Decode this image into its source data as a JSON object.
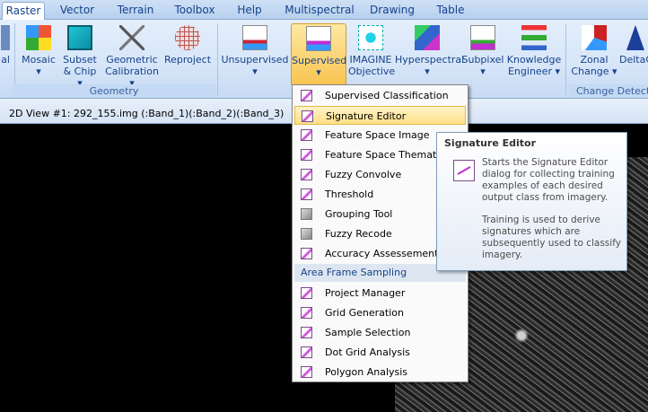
{
  "tabs": [
    "Raster",
    "Vector",
    "Terrain",
    "Toolbox",
    "Help",
    "Multispectral",
    "Drawing",
    "Table"
  ],
  "ribbon": {
    "buttons": [
      {
        "label": "al",
        "label2": "",
        "arrow": "▾"
      },
      {
        "label": "Mosaic",
        "label2": "▾"
      },
      {
        "label": "Subset",
        "label2": "& Chip ▾"
      },
      {
        "label": "Geometric",
        "label2": "Calibration ▾"
      },
      {
        "label": "Reproject",
        "label2": ""
      },
      {
        "label": "Unsupervised",
        "label2": "▾"
      },
      {
        "label": "Supervised",
        "label2": "▾"
      },
      {
        "label": "IMAGINE",
        "label2": "Objective"
      },
      {
        "label": "Hyperspectral",
        "label2": "▾"
      },
      {
        "label": "Subpixel",
        "label2": "▾"
      },
      {
        "label": "Knowledge",
        "label2": "Engineer ▾"
      },
      {
        "label": "Zonal",
        "label2": "Change ▾"
      },
      {
        "label": "DeltaC",
        "label2": ""
      }
    ],
    "groups": [
      "Geometry",
      "Change Detecti"
    ]
  },
  "viewbar": "2D View #1: 292_155.img (:Band_1)(:Band_2)(:Band_3)",
  "menu": {
    "items1": [
      "Supervised Classification",
      "Signature Editor",
      "Feature Space Image",
      "Feature Space Thematic",
      "Fuzzy Convolve",
      "Threshold",
      "Grouping Tool",
      "Fuzzy Recode",
      "Accuracy Assessement"
    ],
    "header": "Area Frame Sampling",
    "items2": [
      "Project Manager",
      "Grid Generation",
      "Sample Selection",
      "Dot Grid Analysis",
      "Polygon Analysis"
    ]
  },
  "tooltip": {
    "title": "Signature Editor",
    "p1": "Starts the Signature Editor dialog for collecting training examples of each desired output class from imagery.",
    "p2": "Training is used to derive signatures which are subsequently used to classify imagery."
  }
}
